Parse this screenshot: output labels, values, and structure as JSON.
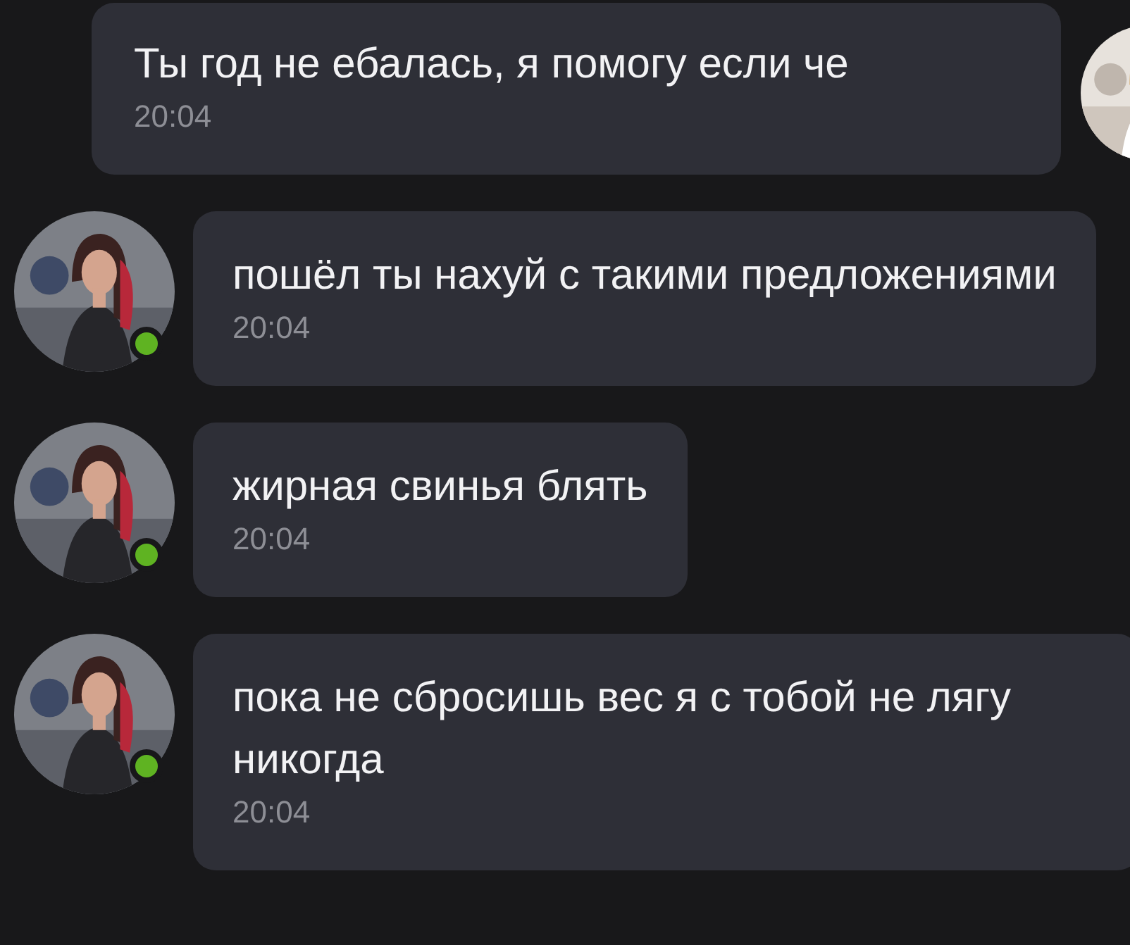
{
  "messages": [
    {
      "kind": "outgoing",
      "text": "Ты год не ебалась, я помогу если че",
      "time": "20:04"
    },
    {
      "kind": "incoming",
      "online": true,
      "text": "пошёл ты нахуй с такими предложениями",
      "time": "20:04"
    },
    {
      "kind": "incoming",
      "online": true,
      "text": "жирная свинья блять",
      "time": "20:04"
    },
    {
      "kind": "incoming",
      "online": true,
      "text": "пока не сбросишь вес я с тобой не лягу никогда",
      "time": "20:04"
    }
  ]
}
